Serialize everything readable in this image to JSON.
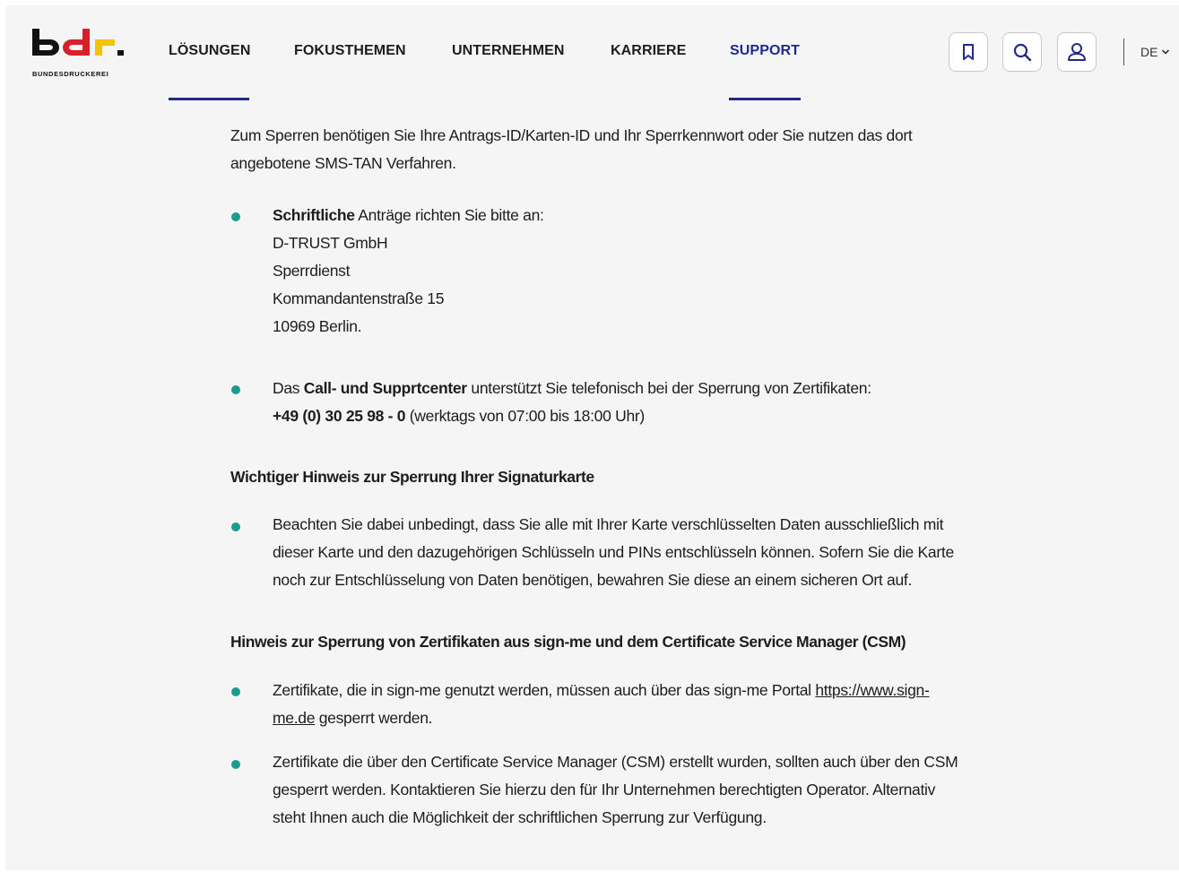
{
  "brand": {
    "logo_text": "bdr.",
    "logo_subtitle": "BUNDESDRUCKEREI",
    "colors": {
      "black": "#111111",
      "red": "#d9202a",
      "gold": "#f2c400"
    }
  },
  "nav": {
    "items": [
      {
        "label": "LÖSUNGEN"
      },
      {
        "label": "FOKUSTHEMEN"
      },
      {
        "label": "UNTERNEHMEN"
      },
      {
        "label": "KARRIERE"
      },
      {
        "label": "SUPPORT"
      }
    ],
    "active_color": "#1f2a8c"
  },
  "actions": {
    "bookmark_icon": "bookmark-icon",
    "search_icon": "search-icon",
    "user_icon": "user-icon",
    "language": "DE"
  },
  "content": {
    "intro_line1": "Zum Sperren benötigen Sie Ihre Antrags-ID/Karten-ID und Ihr Sperrkennwort oder Sie nutzen das dort",
    "intro_line2": "angebotene SMS-TAN Verfahren.",
    "written": {
      "bold": "Schriftliche",
      "rest": " Anträge richten Sie bitte an:",
      "address": [
        "D-TRUST GmbH",
        "Sperrdienst",
        "Kommandantenstraße 15",
        "10969 Berlin."
      ]
    },
    "callcenter": {
      "pre": "Das ",
      "bold": "Call- und Supprtcenter",
      "rest": " unterstützt Sie telefonisch bei der Sperrung von Zertifikaten:",
      "phone": "+49 (0) 30 25 98 - 0",
      "hours": " (werktags von 07:00 bis 18:00 Uhr)"
    },
    "heading1": "Wichtiger Hinweis zur Sperrung Ihrer Signaturkarte",
    "note1": [
      "Beachten Sie dabei unbedingt, dass Sie alle mit Ihrer Karte verschlüsselten Daten ausschließlich mit",
      "dieser Karte und den dazugehörigen Schlüsseln und PINs entschlüsseln können. Sofern Sie die Karte",
      "noch zur Entschlüsselung von Daten benötigen, bewahren Sie diese an einem sicheren Ort auf."
    ],
    "heading2": "Hinweis zur Sperrung von Zertifikaten aus sign-me und dem Certificate Service Manager (CSM)",
    "signme": {
      "pre": "Zertifikate, die in sign-me genutzt werden, müssen auch über das sign-me Portal ",
      "link_part1": "https://www.sign-",
      "link_part2": "me.de",
      "post": " gesperrt werden."
    },
    "csm": [
      "Zertifikate die über den Certificate Service Manager (CSM) erstellt wurden, sollten auch über den CSM",
      "gesperrt werden. Kontaktieren Sie hierzu den für Ihr Unternehmen berechtigten Operator. Alternativ",
      "steht Ihnen auch die Möglichkeit der schriftlichen Sperrung zur Verfügung."
    ],
    "bullet_color": "#1b9c8c"
  }
}
